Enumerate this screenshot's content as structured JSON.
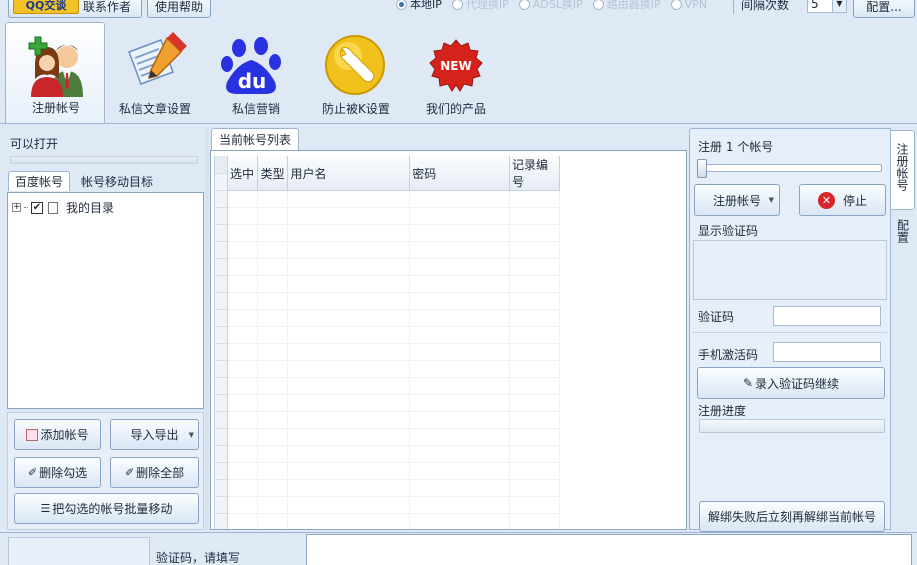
{
  "top": {
    "qq_label": "QQ交谈",
    "contact_label": "联系作者",
    "help_label": "使用帮助",
    "radios": [
      "本地IP",
      "代理换IP",
      "ADSL换IP",
      "路由器换IP",
      "VPN"
    ],
    "interval_label": "间隔次数",
    "interval_value": "5",
    "config_label": "配置..."
  },
  "ribbon": [
    {
      "label": "注册帐号",
      "icon": "users-icon"
    },
    {
      "label": "私信文章设置",
      "icon": "edit-document-icon"
    },
    {
      "label": "私信营销",
      "icon": "baidu-paw-icon"
    },
    {
      "label": "防止被K设置",
      "icon": "wrench-icon"
    },
    {
      "label": "我们的产品",
      "icon": "new-badge-icon"
    }
  ],
  "left": {
    "can_open": "可以打开",
    "tabs": [
      "百度帐号",
      "帐号移动目标"
    ],
    "tree_root": "我的目录",
    "buttons": {
      "add": "添加帐号",
      "import_export": "导入导出",
      "delete_checked": "删除勾选",
      "delete_all": "删除全部",
      "batch_move": "把勾选的帐号批量移动"
    }
  },
  "center": {
    "tab": "当前帐号列表",
    "columns": [
      "选中",
      "类型",
      "用户名",
      "密码",
      "记录编号"
    ]
  },
  "right": {
    "register_count": "注册 1 个帐号",
    "register_btn": "注册帐号",
    "stop_btn": "停止",
    "show_captcha": "显示验证码",
    "captcha_label": "验证码",
    "phone_label": "手机激活码",
    "enter_captcha_btn": "录入验证码继续",
    "progress_label": "注册进度",
    "unbind_btn": "解绑失败后立刻再解绑当前帐号",
    "side_tabs": [
      "注册帐号",
      "配置"
    ]
  },
  "status": {
    "captcha_prompt": "验证码，请填写"
  }
}
